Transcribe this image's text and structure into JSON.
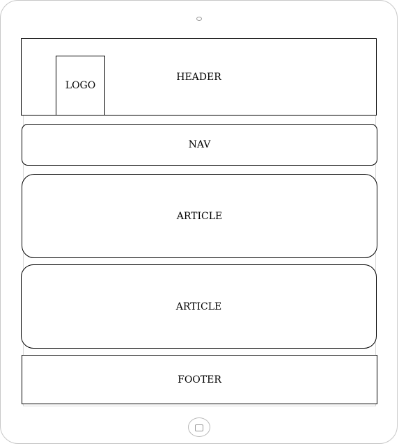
{
  "diagram": {
    "header_label": "HEADER",
    "logo_label": "LOGO",
    "nav_label": "NAV",
    "articles": [
      {
        "label": "ARTICLE"
      },
      {
        "label": "ARTICLE"
      }
    ],
    "footer_label": "FOOTER"
  }
}
